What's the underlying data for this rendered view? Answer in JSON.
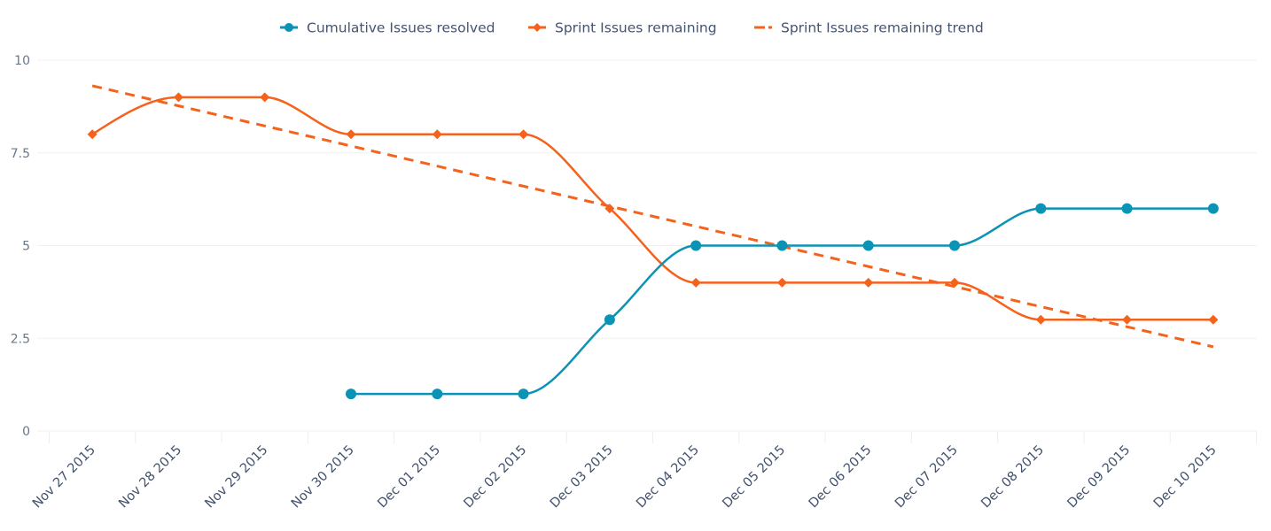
{
  "chart_data": {
    "type": "line",
    "title": "",
    "xlabel": "",
    "ylabel": "",
    "ylim": [
      0,
      10
    ],
    "yticks": [
      "0",
      "2.5",
      "5",
      "7.5",
      "10"
    ],
    "ytick_values": [
      0,
      2.5,
      5,
      7.5,
      10
    ],
    "grid": true,
    "legend_position": "top-center",
    "categories": [
      "Nov 27 2015",
      "Nov 28 2015",
      "Nov 29 2015",
      "Nov 30 2015",
      "Dec 01 2015",
      "Dec 02 2015",
      "Dec 03 2015",
      "Dec 04 2015",
      "Dec 05 2015",
      "Dec 06 2015",
      "Dec 07 2015",
      "Dec 08 2015",
      "Dec 09 2015",
      "Dec 10 2015"
    ],
    "series": [
      {
        "name": "Cumulative Issues resolved",
        "color": "#0b93b5",
        "marker": "circle",
        "style": "solid",
        "values": [
          null,
          null,
          null,
          1,
          1,
          1,
          3,
          5,
          5,
          5,
          5,
          6,
          6,
          6
        ]
      },
      {
        "name": "Sprint Issues remaining",
        "color": "#f4621c",
        "marker": "diamond",
        "style": "solid",
        "values": [
          8,
          9,
          9,
          8,
          8,
          8,
          6,
          4,
          4,
          4,
          4,
          3,
          3,
          3
        ]
      },
      {
        "name": "Sprint Issues remaining trend",
        "color": "#f4621c",
        "marker": "none",
        "style": "dashed",
        "values": [
          9.31,
          8.77,
          8.23,
          7.69,
          7.15,
          6.61,
          6.06,
          5.52,
          4.98,
          4.44,
          3.9,
          3.36,
          2.82,
          2.27
        ]
      }
    ]
  }
}
